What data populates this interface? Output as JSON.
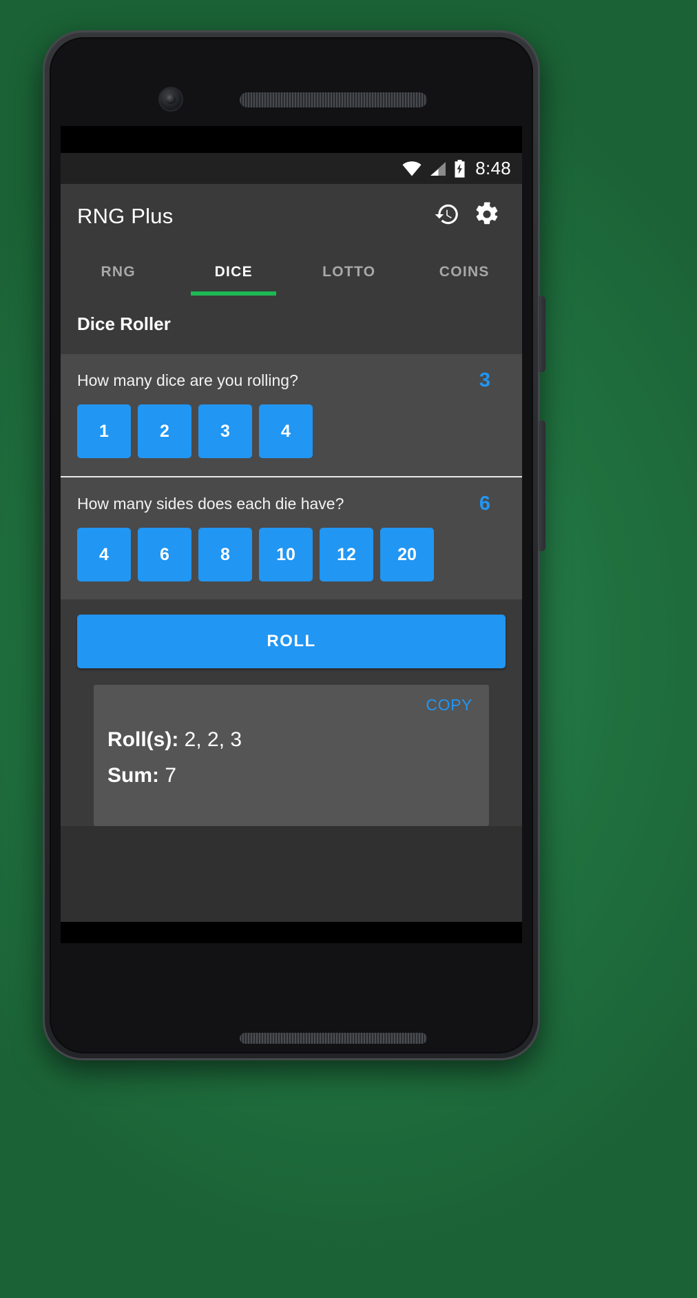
{
  "status_bar": {
    "time": "8:48",
    "icons": [
      "wifi-icon",
      "cellular-signal-icon",
      "battery-charging-icon"
    ]
  },
  "app_bar": {
    "title": "RNG Plus",
    "actions": [
      {
        "name": "history-icon",
        "label": "History"
      },
      {
        "name": "gear-icon",
        "label": "Settings"
      }
    ]
  },
  "tabs": [
    {
      "label": "RNG",
      "active": false
    },
    {
      "label": "DICE",
      "active": true
    },
    {
      "label": "LOTTO",
      "active": false
    },
    {
      "label": "COINS",
      "active": false
    }
  ],
  "section": {
    "title": "Dice Roller"
  },
  "dice_count": {
    "question": "How many dice are you rolling?",
    "value": "3",
    "options": [
      "1",
      "2",
      "3",
      "4"
    ]
  },
  "dice_sides": {
    "question": "How many sides does each die have?",
    "value": "6",
    "options": [
      "4",
      "6",
      "8",
      "10",
      "12",
      "20"
    ]
  },
  "actions": {
    "roll_label": "ROLL",
    "copy_label": "COPY"
  },
  "results": {
    "rolls_label": "Roll(s):",
    "rolls_value": "2, 2, 3",
    "sum_label": "Sum:",
    "sum_value": "7"
  },
  "colors": {
    "accent_blue": "#2196f3",
    "tab_indicator_green": "#1db954",
    "app_bar_bg": "#3a3a3a",
    "content_bg": "#303030",
    "picker_bg": "#4a4a4a",
    "card_bg": "#555555"
  }
}
